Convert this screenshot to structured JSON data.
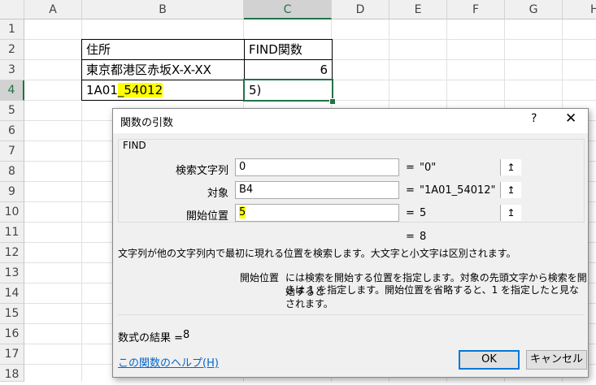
{
  "columns": [
    "A",
    "B",
    "C",
    "D",
    "E",
    "F",
    "G",
    "H"
  ],
  "rows": [
    "1",
    "2",
    "3",
    "4",
    "5",
    "6",
    "7",
    "8",
    "9",
    "10",
    "11",
    "12",
    "13",
    "14",
    "15",
    "16",
    "17",
    "18"
  ],
  "cells": {
    "b2": "住所",
    "c2": "FIND関数",
    "b3": "東京都港区赤坂X-X-XX",
    "c3": "6",
    "b4_plain": "1A01",
    "b4_highlight": "_54012",
    "c4": "5)"
  },
  "dialog": {
    "title": "関数の引数",
    "help_glyph": "?",
    "close_glyph": "✕",
    "function_name": "FIND",
    "args": [
      {
        "label": "検索文字列",
        "value": "0",
        "result": "\"0\""
      },
      {
        "label": "対象",
        "value": "B4",
        "result": "\"1A01_54012\""
      },
      {
        "label": "開始位置",
        "value": "5",
        "result": "5"
      }
    ],
    "ref_icon": "↥",
    "equals": "=",
    "formula_result": "8",
    "description": "文字列が他の文字列内で最初に現れる位置を検索します。大文字と小文字は区別されます。",
    "arg_help_name": "開始位置",
    "arg_help_line1": "には検索を開始する位置を指定します。対象の先頭文字から検索を開始すると",
    "arg_help_line2": "きは 1 を指定します。開始位置を省略すると、1 を指定したと見なされます。",
    "result_label": "数式の結果 =",
    "result_value": "8",
    "help_link": "この関数のヘルプ(H)",
    "ok_label": "OK",
    "cancel_label": "キャンセル"
  },
  "colors": {
    "accent_green": "#217346",
    "highlight_yellow": "#ffff00",
    "dialog_bg": "#f0f0f0",
    "ok_border": "#0078d7",
    "link_blue": "#0066cc"
  }
}
